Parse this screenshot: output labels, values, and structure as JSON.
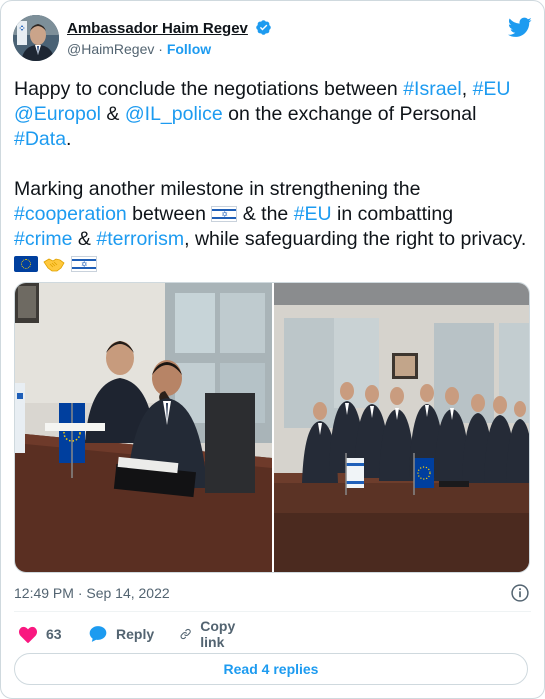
{
  "author": {
    "display_name": "Ambassador Haim Regev",
    "handle": "@HaimRegev",
    "separator": "·",
    "follow_label": "Follow"
  },
  "tweet": {
    "line1_prefix": "Happy to conclude the negotiations between ",
    "tag_israel": "#Israel",
    "comma": ",",
    "tag_eu": "#EU",
    "mention_europol": "@Europol",
    "amp1": " & ",
    "mention_ilpolice": "@IL_police",
    "line2_mid": " on the exchange of Personal ",
    "tag_data": "#Data",
    "period": ".",
    "p2_start": "Marking another milestone in strengthening the ",
    "tag_cooperation": "#cooperation",
    "between": " between ",
    "and_the": " & the ",
    "tag_eu2": "#EU",
    "in_combatting": " in combatting ",
    "tag_crime": "#crime",
    "amp2": " & ",
    "tag_terrorism": "#terrorism",
    "end_text": ", while safeguarding the right to privacy. ",
    "emoji_names": [
      "israel-flag",
      "eu-flag",
      "handshake"
    ]
  },
  "timestamp": "12:49 PM · Sep 14, 2022",
  "actions": {
    "like_count": "63",
    "reply_label": "Reply",
    "copy_label": "Copy link"
  },
  "read_replies_label": "Read 4 replies",
  "colors": {
    "link": "#1d9bf0",
    "like": "#f91880",
    "text": "#0f1419",
    "secondary": "#536471"
  }
}
